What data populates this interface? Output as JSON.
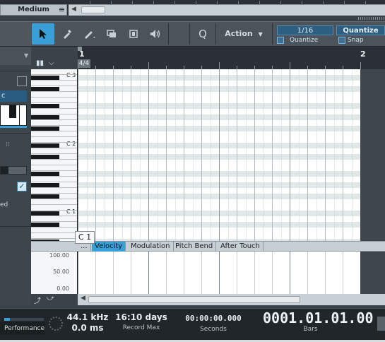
{
  "header": {
    "preset_name": "Medium"
  },
  "toolbar": {
    "quantize_button": "Q",
    "action_label": "Action",
    "quantize_value": "1/16",
    "quantize_label": "Quantize",
    "quantize_title": "Quantize",
    "snap_label": "Snap"
  },
  "inspector": {
    "field_text": "c",
    "ed_text": "ed"
  },
  "ruler": {
    "bar1": "1",
    "bar2": "2",
    "time_signature": "4/4"
  },
  "piano": {
    "octaves": [
      "C 3",
      "C 2",
      "C 1"
    ]
  },
  "tooltip": {
    "text": "C 1"
  },
  "controller": {
    "more": "...",
    "tabs": [
      "Velocity",
      "Modulation",
      "Pitch Bend",
      "After Touch"
    ],
    "active_tab": "Velocity",
    "scale": [
      "100.00",
      "50.00",
      "0.00"
    ]
  },
  "transport": {
    "performance_label": "Performance",
    "sample_rate": "44.1 kHz",
    "latency": "0.0 ms",
    "record_days": "16:10 days",
    "record_label": "Record Max",
    "seconds_value": "00:00:00.000",
    "seconds_label": "Seconds",
    "bars_value": "0001.01.01.00",
    "bars_label": "Bars"
  },
  "colors": {
    "accent": "#3a9fd6",
    "panel": "#394047",
    "grid": "#ffffff"
  }
}
